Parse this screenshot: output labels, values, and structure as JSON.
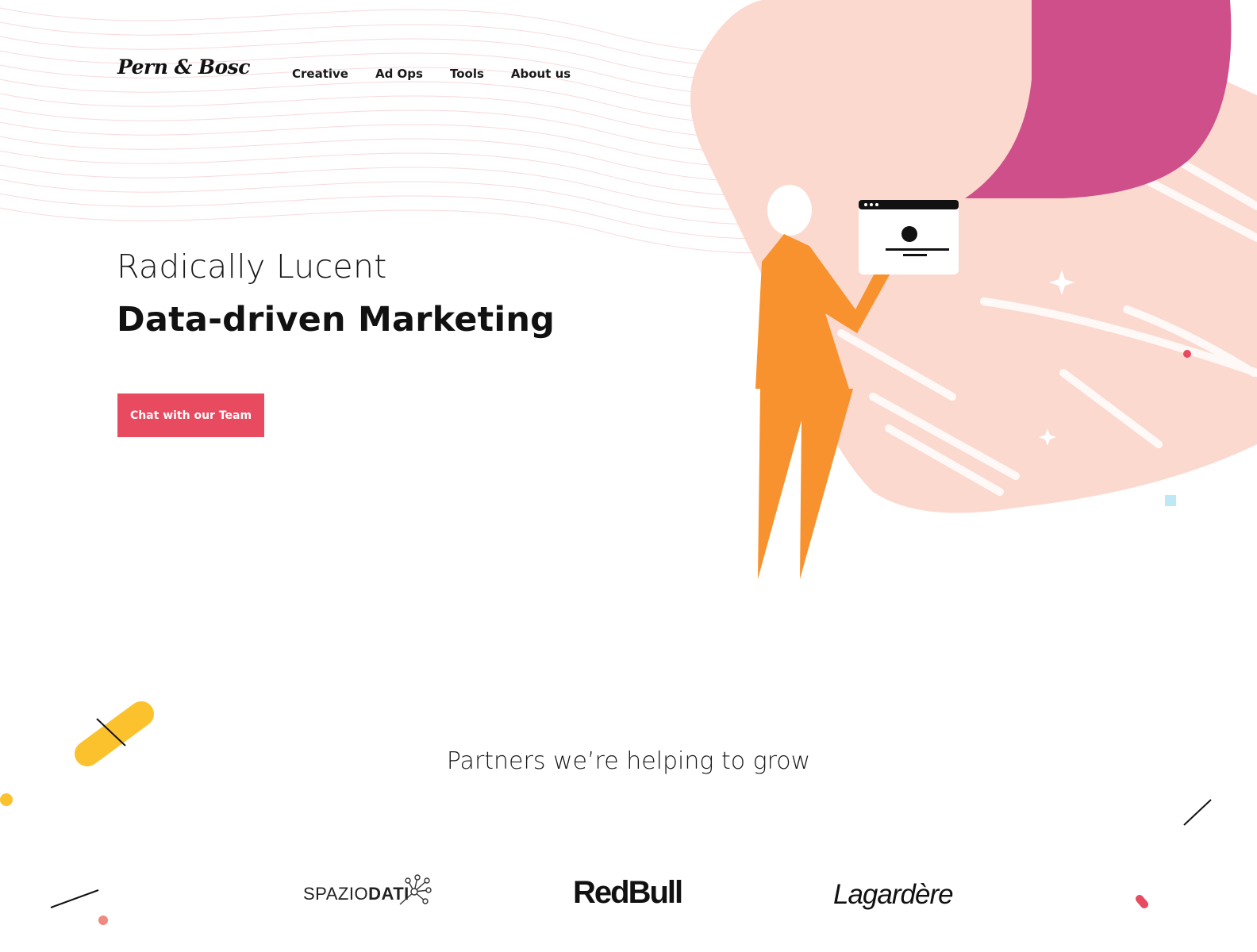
{
  "brand": {
    "logo": "Pern & Bosc"
  },
  "nav": {
    "items": [
      {
        "label": "Creative"
      },
      {
        "label": "Ad Ops"
      },
      {
        "label": "Tools"
      },
      {
        "label": "About us"
      }
    ]
  },
  "hero": {
    "subtitle": "Radically Lucent",
    "title": "Data-driven Marketing",
    "cta_label": "Chat with our Team",
    "cta_color": "#e84a5f"
  },
  "partners": {
    "heading": "Partners we’re helping to grow",
    "logos": {
      "spazio_light": "SPAZIO",
      "spazio_bold": "DATI",
      "redbull": "RedBull",
      "lagardere": "Lagardère"
    }
  },
  "colors": {
    "accent": "#e84a5f",
    "peach": "#fbd9cf",
    "magenta": "#cf4f8b",
    "orange": "#f8922e",
    "yellow": "#fcc22d"
  },
  "icons": {
    "browser_window": "browser-window-icon",
    "spazio_network": "network-nodes-icon"
  }
}
